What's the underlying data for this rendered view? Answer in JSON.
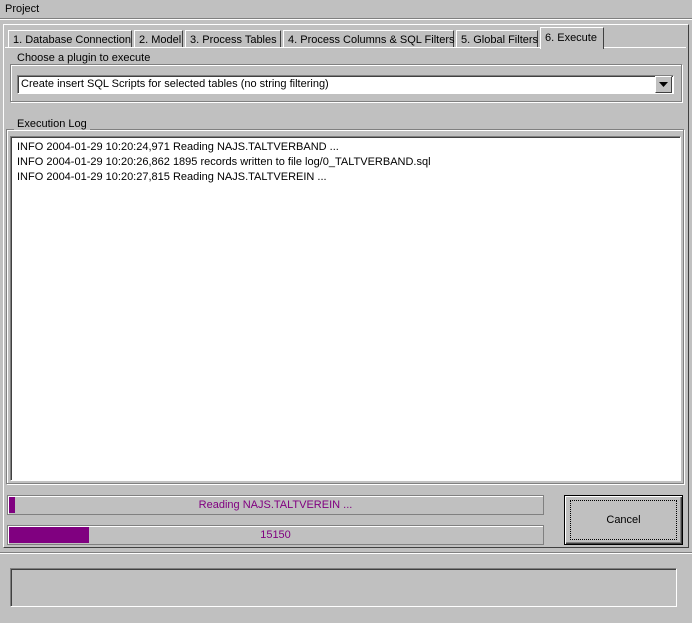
{
  "window": {
    "title": "Project"
  },
  "tabs": [
    {
      "label": "1. Database Connection"
    },
    {
      "label": "2. Model"
    },
    {
      "label": "3. Process Tables"
    },
    {
      "label": "4. Process Columns & SQL Filters"
    },
    {
      "label": "5. Global Filters"
    },
    {
      "label": "6. Execute",
      "active": true
    }
  ],
  "plugin_group": {
    "legend": "Choose a plugin to execute",
    "selected": "Create insert SQL Scripts for selected tables (no string filtering)"
  },
  "log_group": {
    "legend": "Execution Log",
    "lines": [
      "INFO 2004-01-29 10:20:24,971 Reading NAJS.TALTVERBAND ...",
      "INFO 2004-01-29 10:20:26,862 1895 records written to file log/0_TALTVERBAND.sql",
      "INFO 2004-01-29 10:20:27,815 Reading NAJS.TALTVEREIN ..."
    ]
  },
  "progress": {
    "task": {
      "text": "Reading NAJS.TALTVEREIN ...",
      "fraction": 0.01
    },
    "records": {
      "text": "15150",
      "fraction": 0.15
    }
  },
  "buttons": {
    "cancel_label": "Cancel"
  },
  "status": {
    "text": ""
  },
  "colors": {
    "progress_fill": "#800080",
    "background": "#c0c0c0"
  }
}
